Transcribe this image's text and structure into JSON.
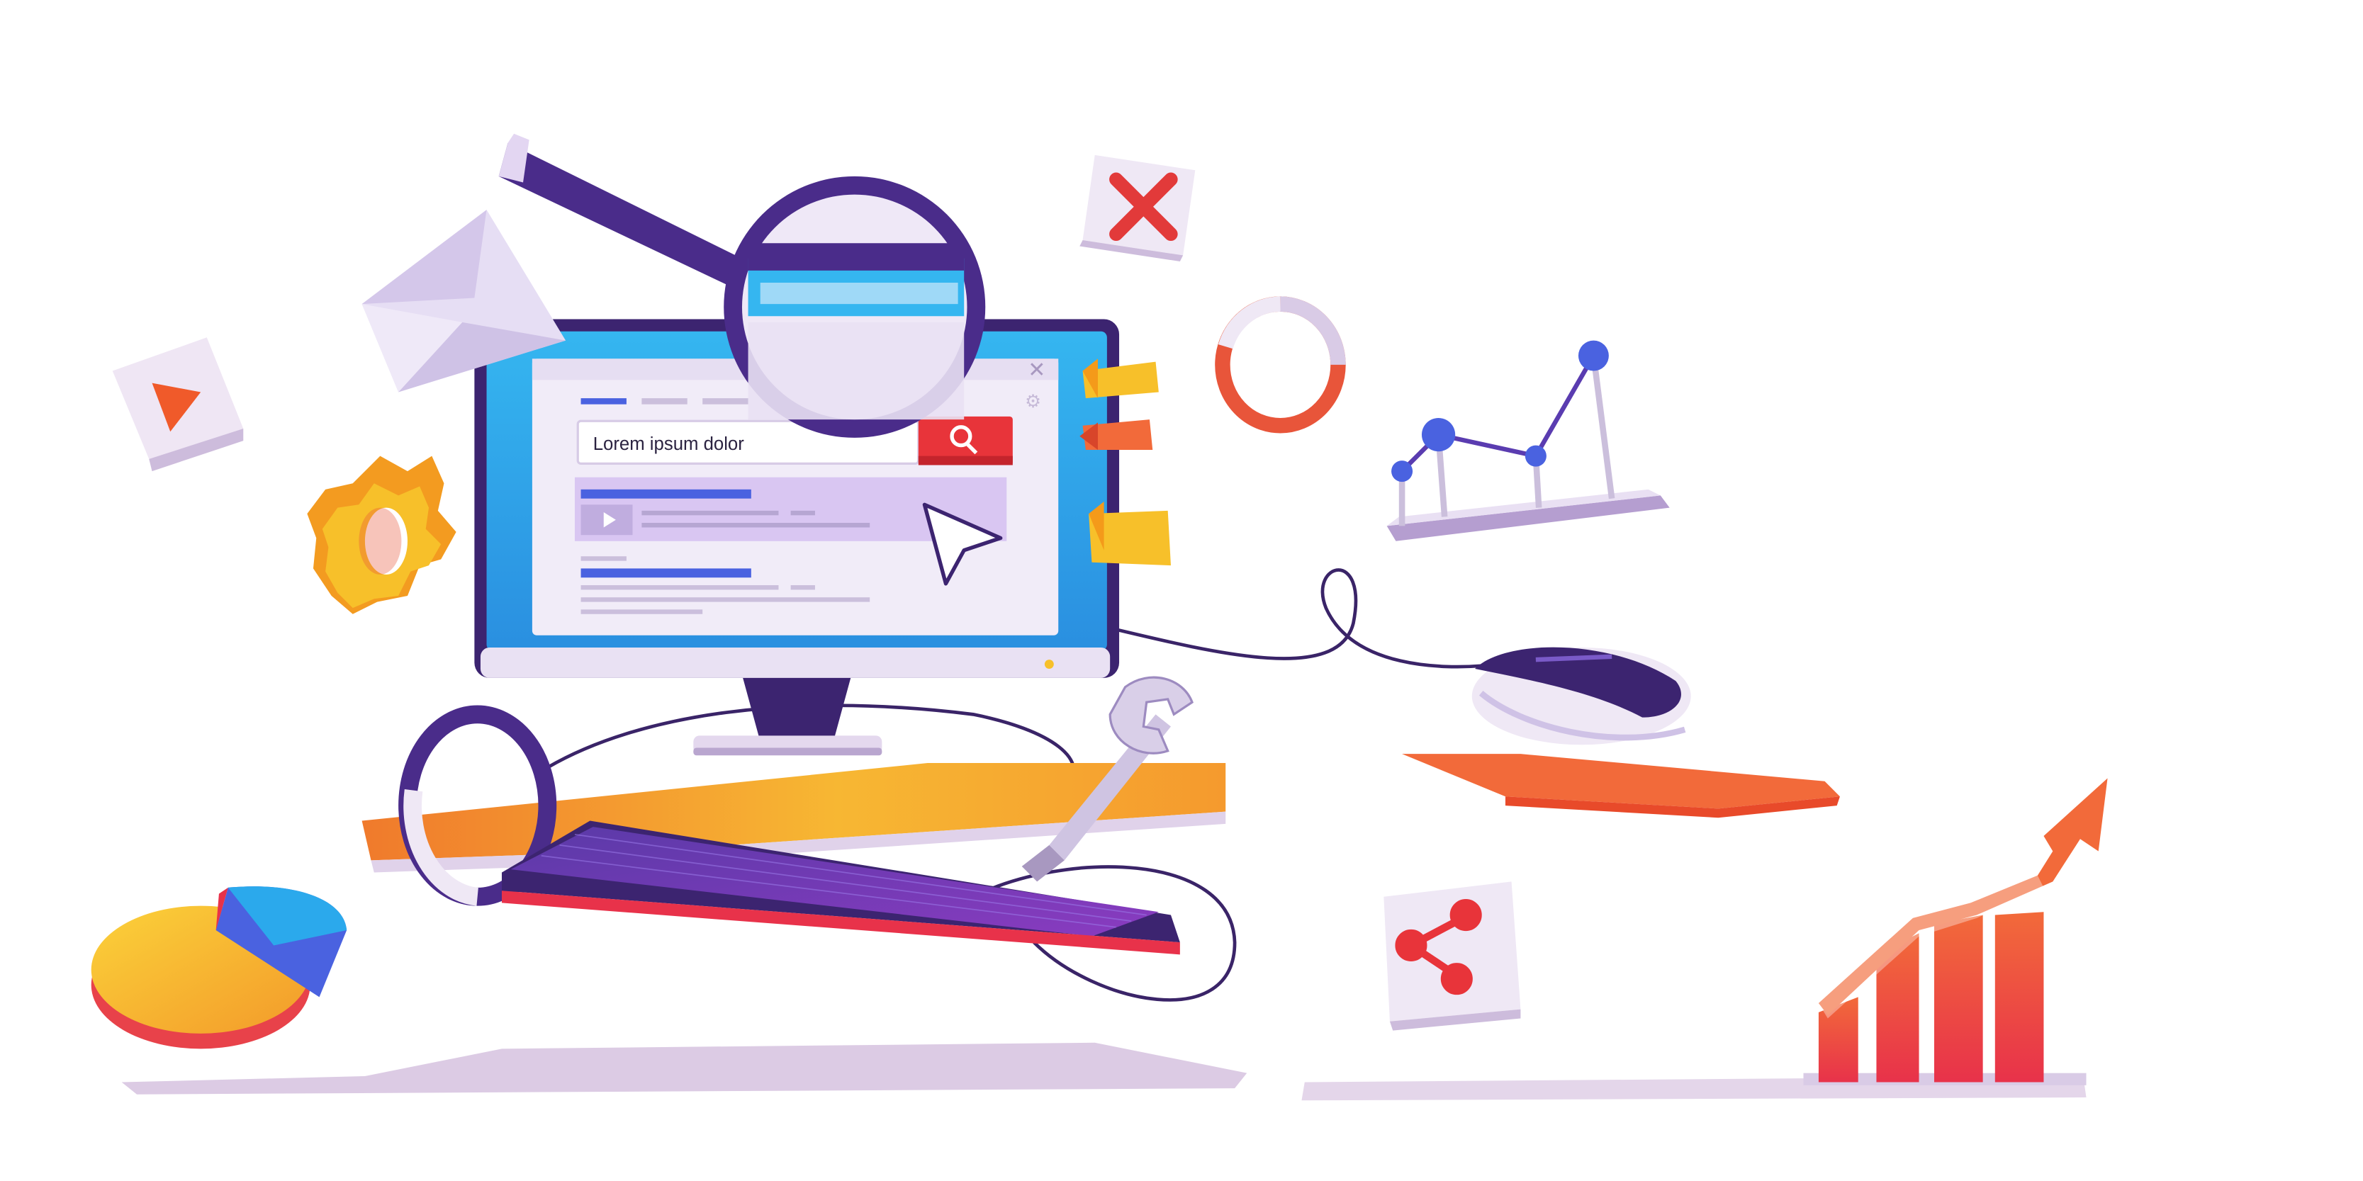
{
  "search": {
    "value": "Lorem ipsum dolor"
  },
  "icons": {
    "magnifier": "magnifier-icon",
    "envelope": "envelope-icon",
    "close": "close-x-icon",
    "play": "play-icon",
    "gear": "gear-icon",
    "ring": "ring-icon",
    "line_chart": "line-chart-icon",
    "pie_chart": "pie-chart-icon",
    "share": "share-icon",
    "growth_chart": "growth-chart-icon",
    "wrench": "wrench-icon",
    "mouse": "mouse-icon",
    "cursor": "cursor-arrow-icon",
    "search_button": "search-icon"
  },
  "colors": {
    "purple_dark": "#3c2470",
    "purple": "#6a4ab0",
    "screen_blue": "#2ba9ec",
    "screen_white": "#f1ecf8",
    "orange": "#f07a2c",
    "yellow": "#f7c02a",
    "red": "#e83a3a",
    "lavender": "#d9cbe6",
    "blue_bar": "#4a62e0"
  }
}
